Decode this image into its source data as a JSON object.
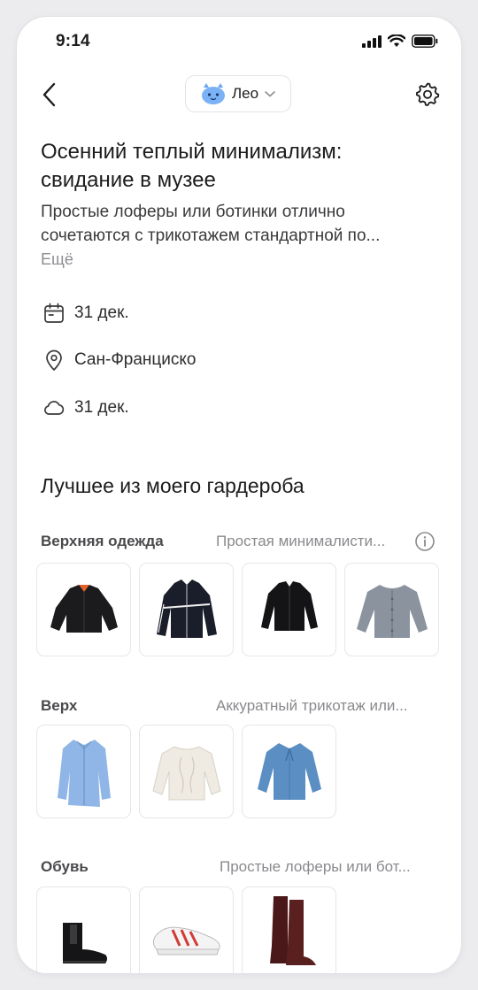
{
  "status_bar": {
    "time": "9:14"
  },
  "nav": {
    "agent_name": "Лео"
  },
  "header": {
    "title": "Осенний теплый минимализм: свидание в музее",
    "description_line1": "Простые лоферы или ботинки отлично",
    "description_line2": "сочетаются с трикотажем стандартной по...",
    "more": "Ещё"
  },
  "meta": {
    "date": "31 дек.",
    "location": "Сан-Франциско",
    "weather": "31 дек."
  },
  "wardrobe": {
    "title": "Лучшее из моего гардероба",
    "categories": [
      {
        "label": "Верхняя одежда",
        "note": "Простая минималисти...",
        "items": [
          "black-bomber-jacket",
          "black-track-jacket",
          "black-cropped-jacket",
          "grey-cardigan"
        ]
      },
      {
        "label": "Верх",
        "note": "Аккуратный трикотаж или...",
        "items": [
          "blue-oversized-shirt",
          "cream-cable-knit-sweater",
          "blue-bow-blouse"
        ]
      },
      {
        "label": "Обувь",
        "note": "Простые лоферы или бот...",
        "items": [
          "black-chelsea-boots",
          "red-white-sneakers",
          "burgundy-knee-boots"
        ]
      }
    ]
  },
  "colors": {
    "text": "#1c1c1e",
    "muted": "#8e8e93",
    "card_border": "#e6e6e9",
    "agent_blue": "#6aa6f0"
  }
}
